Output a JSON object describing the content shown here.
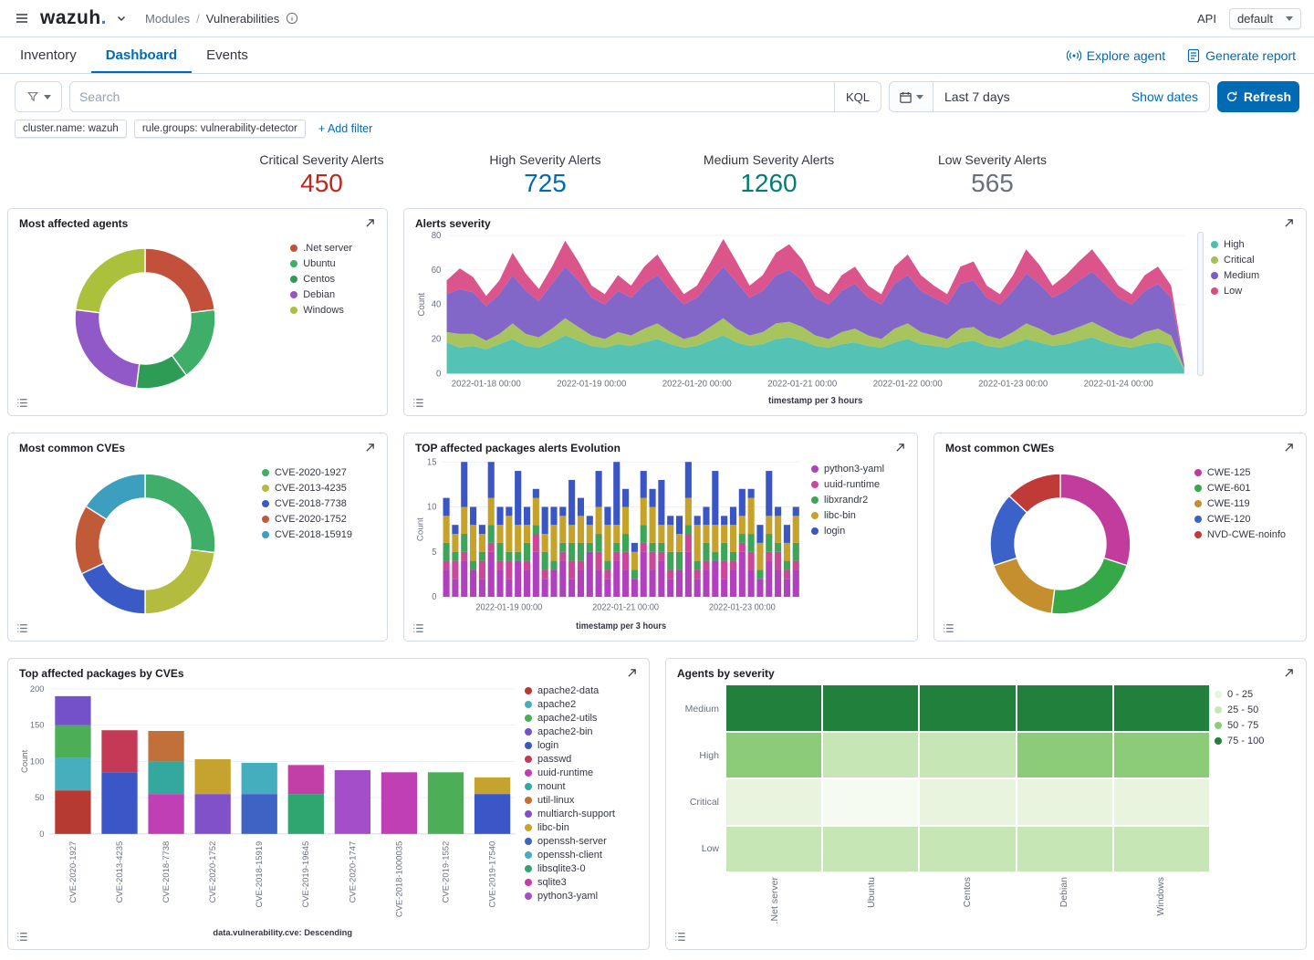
{
  "topbar": {
    "logo_text": "wazuh",
    "logo_dot": ".",
    "breadcrumb": [
      "Modules",
      "Vulnerabilities"
    ],
    "api_label": "API",
    "pattern_select": "default"
  },
  "tabs": {
    "items": [
      "Inventory",
      "Dashboard",
      "Events"
    ],
    "active": "Dashboard",
    "actions": [
      {
        "label": "Explore agent"
      },
      {
        "label": "Generate report"
      }
    ]
  },
  "search": {
    "placeholder": "Search",
    "kql_label": "KQL",
    "time_range": "Last 7 days",
    "show_dates_label": "Show dates",
    "refresh_label": "Refresh"
  },
  "filters": {
    "pills": [
      "cluster.name: wazuh",
      "rule.groups: vulnerability-detector"
    ],
    "add_label": "+ Add filter"
  },
  "stats": [
    {
      "label": "Critical Severity Alerts",
      "value": "450",
      "color": "#BD271E"
    },
    {
      "label": "High Severity Alerts",
      "value": "725",
      "color": "#006BB4"
    },
    {
      "label": "Medium Severity Alerts",
      "value": "1260",
      "color": "#017D73"
    },
    {
      "label": "Low Severity Alerts",
      "value": "565",
      "color": "#69707D"
    }
  ],
  "chart_data": [
    {
      "type": "donut",
      "title": "Most affected agents",
      "labels": [
        ".Net server",
        "Ubuntu",
        "Centos",
        "Debian",
        "Windows"
      ],
      "values": [
        23,
        17,
        12,
        25,
        23
      ],
      "colors": [
        "#C3503B",
        "#3FAE69",
        "#2E9C55",
        "#9159C8",
        "#ABC13C"
      ]
    },
    {
      "type": "area",
      "title": "Alerts severity",
      "ylabel": "Count",
      "xlabel": "timestamp per 3 hours",
      "ylim": [
        0,
        80
      ],
      "yticks": [
        0,
        20,
        40,
        60,
        80
      ],
      "x_ticks": [
        {
          "i": 3,
          "label": "2022-01-18 00:00"
        },
        {
          "i": 11,
          "label": "2022-01-19 00:00"
        },
        {
          "i": 19,
          "label": "2022-01-20 00:00"
        },
        {
          "i": 27,
          "label": "2022-01-21 00:00"
        },
        {
          "i": 35,
          "label": "2022-01-22 00:00"
        },
        {
          "i": 43,
          "label": "2022-01-23 00:00"
        },
        {
          "i": 51,
          "label": "2022-01-24 00:00"
        }
      ],
      "colors": [
        "#4CBFB2",
        "#A3C155",
        "#7B5FC5",
        "#DA4B86"
      ],
      "series": [
        {
          "name": "High",
          "values": [
            18,
            15,
            16,
            14,
            17,
            20,
            16,
            15,
            18,
            22,
            19,
            16,
            15,
            17,
            16,
            18,
            20,
            17,
            15,
            16,
            19,
            22,
            18,
            16,
            17,
            20,
            21,
            19,
            16,
            15,
            17,
            18,
            16,
            15,
            18,
            20,
            17,
            16,
            15,
            18,
            19,
            16,
            15,
            17,
            20,
            18,
            16,
            17,
            19,
            21,
            18,
            16,
            15,
            17,
            18,
            16,
            2
          ]
        },
        {
          "name": "Critical",
          "values": [
            6,
            8,
            7,
            5,
            6,
            9,
            7,
            6,
            8,
            10,
            8,
            6,
            5,
            7,
            6,
            8,
            9,
            7,
            5,
            6,
            8,
            10,
            8,
            6,
            7,
            9,
            9,
            8,
            6,
            5,
            7,
            8,
            6,
            5,
            8,
            9,
            7,
            6,
            5,
            8,
            8,
            6,
            5,
            7,
            9,
            8,
            6,
            7,
            8,
            9,
            8,
            6,
            5,
            7,
            8,
            6,
            1
          ]
        },
        {
          "name": "Medium",
          "values": [
            22,
            26,
            24,
            20,
            23,
            28,
            25,
            21,
            26,
            30,
            27,
            22,
            20,
            24,
            22,
            26,
            28,
            24,
            20,
            22,
            26,
            30,
            27,
            22,
            24,
            28,
            30,
            27,
            22,
            20,
            24,
            26,
            22,
            20,
            26,
            28,
            24,
            22,
            20,
            26,
            27,
            22,
            20,
            24,
            29,
            26,
            22,
            24,
            27,
            29,
            26,
            22,
            20,
            24,
            26,
            22,
            1
          ]
        },
        {
          "name": "Low",
          "values": [
            8,
            12,
            9,
            6,
            8,
            13,
            10,
            7,
            10,
            15,
            11,
            7,
            6,
            9,
            7,
            10,
            12,
            9,
            6,
            7,
            11,
            16,
            12,
            7,
            9,
            13,
            15,
            12,
            7,
            6,
            9,
            10,
            7,
            6,
            10,
            12,
            9,
            7,
            6,
            10,
            11,
            7,
            6,
            9,
            14,
            11,
            7,
            9,
            11,
            13,
            10,
            7,
            6,
            9,
            10,
            7,
            1
          ]
        }
      ]
    },
    {
      "type": "donut",
      "title": "Most common CVEs",
      "labels": [
        "CVE-2020-1927",
        "CVE-2013-4235",
        "CVE-2018-7738",
        "CVE-2020-1752",
        "CVE-2018-15919"
      ],
      "values": [
        27,
        23,
        18,
        16,
        16
      ],
      "colors": [
        "#3FAE69",
        "#B3BC3F",
        "#3A5BC7",
        "#C05A38",
        "#3C9FC0"
      ]
    },
    {
      "type": "stacked-bar",
      "title": "TOP affected packages alerts Evolution",
      "ylabel": "Count",
      "xlabel": "timestamp per 3 hours",
      "ylim": [
        0,
        15
      ],
      "yticks": [
        0,
        5,
        10,
        15
      ],
      "x_ticks": [
        {
          "i": 7,
          "label": "2022-01-19 00:00"
        },
        {
          "i": 20,
          "label": "2022-01-21 00:00"
        },
        {
          "i": 33,
          "label": "2022-01-23 00:00"
        }
      ],
      "colors": [
        "#B13FBE",
        "#CC4799",
        "#3DA557",
        "#C7A22B",
        "#3A55C5"
      ],
      "series": [
        {
          "name": "python3-yaml",
          "values": [
            3,
            2,
            4,
            3,
            2,
            5,
            3,
            2,
            4,
            3,
            5,
            2,
            3,
            4,
            2,
            3,
            5,
            3,
            2,
            4,
            3,
            2,
            5,
            3,
            4,
            2,
            3,
            5,
            2,
            3,
            4,
            2,
            3,
            5,
            3,
            2,
            4,
            3,
            2,
            3
          ]
        },
        {
          "name": "uuid-runtime",
          "values": [
            1,
            2,
            1,
            0,
            2,
            1,
            1,
            2,
            0,
            1,
            2,
            1,
            0,
            1,
            2,
            1,
            0,
            2,
            1,
            1,
            2,
            0,
            1,
            2,
            1,
            1,
            0,
            2,
            1,
            1,
            0,
            2,
            1,
            1,
            2,
            0,
            1,
            2,
            1,
            1
          ]
        },
        {
          "name": "libxrandr2",
          "values": [
            2,
            1,
            2,
            1,
            1,
            2,
            2,
            1,
            1,
            2,
            1,
            2,
            1,
            1,
            2,
            2,
            1,
            2,
            1,
            1,
            2,
            1,
            2,
            1,
            1,
            2,
            2,
            1,
            1,
            2,
            1,
            2,
            1,
            1,
            2,
            1,
            2,
            1,
            1,
            2
          ]
        },
        {
          "name": "libc-bin",
          "values": [
            3,
            2,
            3,
            4,
            2,
            3,
            2,
            4,
            3,
            2,
            3,
            2,
            4,
            3,
            2,
            3,
            2,
            3,
            4,
            2,
            3,
            2,
            3,
            4,
            2,
            3,
            2,
            3,
            4,
            2,
            3,
            2,
            3,
            2,
            4,
            3,
            2,
            3,
            2,
            3
          ]
        },
        {
          "name": "login",
          "values": [
            2,
            1,
            5,
            2,
            1,
            4,
            2,
            1,
            6,
            2,
            1,
            3,
            2,
            1,
            5,
            2,
            1,
            4,
            2,
            7,
            2,
            1,
            3,
            2,
            5,
            1,
            2,
            4,
            1,
            2,
            6,
            1,
            2,
            3,
            1,
            2,
            5,
            1,
            2,
            1
          ]
        }
      ]
    },
    {
      "type": "donut",
      "title": "Most common CWEs",
      "labels": [
        "CWE-125",
        "CWE-601",
        "CWE-119",
        "CWE-120",
        "NVD-CWE-noinfo"
      ],
      "values": [
        30,
        22,
        18,
        17,
        13
      ],
      "colors": [
        "#C23C9E",
        "#35A847",
        "#C48F2C",
        "#3B62C8",
        "#C03A38"
      ]
    },
    {
      "type": "stacked-bar-categorical",
      "title": "Top affected packages by CVEs",
      "ylabel": "Count",
      "xlabel": "data.vulnerability.cve: Descending",
      "ylim": [
        0,
        200
      ],
      "yticks": [
        0,
        50,
        100,
        150,
        200
      ],
      "legend": [
        {
          "name": "apache2-data",
          "color": "#B73A32"
        },
        {
          "name": "apache2",
          "color": "#46AEBC"
        },
        {
          "name": "apache2-utils",
          "color": "#4CAF57"
        },
        {
          "name": "apache2-bin",
          "color": "#7450C9"
        },
        {
          "name": "login",
          "color": "#3B56C6"
        },
        {
          "name": "passwd",
          "color": "#C43A56"
        },
        {
          "name": "uuid-runtime",
          "color": "#C13FB4"
        },
        {
          "name": "mount",
          "color": "#32A89E"
        },
        {
          "name": "util-linux",
          "color": "#C2703A"
        },
        {
          "name": "multiarch-support",
          "color": "#8052C9"
        },
        {
          "name": "libc-bin",
          "color": "#C6A32E"
        },
        {
          "name": "openssh-server",
          "color": "#3E63C4"
        },
        {
          "name": "openssh-client",
          "color": "#44AEBF"
        },
        {
          "name": "libsqlite3-0",
          "color": "#2FA66F"
        },
        {
          "name": "sqlite3",
          "color": "#C23FA8"
        },
        {
          "name": "python3-yaml",
          "color": "#A44FC9"
        }
      ],
      "bars": [
        {
          "label": "CVE-2020-1927",
          "segments": [
            [
              "apache2-data",
              60
            ],
            [
              "apache2",
              45
            ],
            [
              "apache2-utils",
              45
            ],
            [
              "apache2-bin",
              40
            ]
          ]
        },
        {
          "label": "CVE-2013-4235",
          "segments": [
            [
              "login",
              85
            ],
            [
              "passwd",
              58
            ]
          ]
        },
        {
          "label": "CVE-2018-7738",
          "segments": [
            [
              "uuid-runtime",
              55
            ],
            [
              "mount",
              45
            ],
            [
              "util-linux",
              42
            ]
          ]
        },
        {
          "label": "CVE-2020-1752",
          "segments": [
            [
              "multiarch-support",
              55
            ],
            [
              "libc-bin",
              48
            ]
          ]
        },
        {
          "label": "CVE-2018-15919",
          "segments": [
            [
              "openssh-server",
              55
            ],
            [
              "openssh-client",
              43
            ]
          ]
        },
        {
          "label": "CVE-2019-19645",
          "segments": [
            [
              "libsqlite3-0",
              55
            ],
            [
              "sqlite3",
              40
            ]
          ]
        },
        {
          "label": "CVE-2020-1747",
          "segments": [
            [
              "python3-yaml",
              88
            ]
          ]
        },
        {
          "label": "CVE-2018-1000035",
          "segments": [
            [
              "uuid-runtime",
              85
            ]
          ]
        },
        {
          "label": "CVE-2019-1552",
          "segments": [
            [
              "apache2-utils",
              85
            ]
          ]
        },
        {
          "label": "CVE-2019-17540",
          "segments": [
            [
              "login",
              55
            ],
            [
              "libc-bin",
              23
            ]
          ]
        }
      ]
    },
    {
      "type": "heatmap",
      "title": "Agents by severity",
      "rows": [
        "Medium",
        "High",
        "Critical",
        "Low"
      ],
      "columns": [
        ".Net server",
        "Ubuntu",
        "Centos",
        "Debian",
        "Windows"
      ],
      "values": [
        [
          90,
          92,
          88,
          91,
          95
        ],
        [
          62,
          40,
          42,
          58,
          68
        ],
        [
          20,
          3,
          20,
          21,
          22
        ],
        [
          32,
          30,
          33,
          31,
          32
        ]
      ],
      "buckets": [
        {
          "label": "0 - 25",
          "color": "#E8F4DE"
        },
        {
          "label": "25 - 50",
          "color": "#C7E6B6"
        },
        {
          "label": "50 - 75",
          "color": "#8CCB77"
        },
        {
          "label": "75 - 100",
          "color": "#20803C"
        }
      ]
    }
  ]
}
